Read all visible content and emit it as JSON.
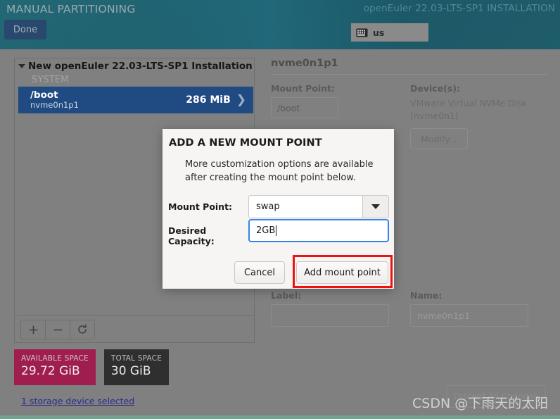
{
  "header": {
    "title": "MANUAL PARTITIONING",
    "product": "openEuler 22.03-LTS-SP1 INSTALLATION",
    "done_label": "Done",
    "keyboard_layout": "us",
    "keyboard_icon": "keyboard-icon",
    "colors": {
      "background_teal": "#1d5c6c",
      "done_button": "#28486e"
    }
  },
  "left_panel": {
    "group": {
      "title": "New openEuler 22.03-LTS-SP1 Installation",
      "expander_icon": "triangle-down-icon",
      "section_label": "SYSTEM",
      "partitions": [
        {
          "mount": "/boot",
          "device": "nvme0n1p1",
          "size": "286 MiB",
          "chevron_icon": "chevron-right-icon",
          "selected": true
        }
      ]
    },
    "toolbar": {
      "add_label": "+",
      "add_icon": "plus-icon",
      "remove_label": "−",
      "remove_icon": "minus-icon",
      "refresh_label": "⟳",
      "refresh_icon": "refresh-icon"
    },
    "space": {
      "available_label": "AVAILABLE SPACE",
      "available_value": "29.72 GiB",
      "available_color": "#9f1e4f",
      "total_label": "TOTAL SPACE",
      "total_value": "30 GiB",
      "total_color": "#2f2f2f"
    },
    "storage_link": "1 storage device selected"
  },
  "right_panel": {
    "title": "nvme0n1p1",
    "mount_point_label": "Mount Point:",
    "mount_point_value": "/boot",
    "devices_label": "Device(s):",
    "devices_value": "VMware Virtual NVMe Disk (nvme0n1)",
    "modify_label": "Modify...",
    "label_label": "Label:",
    "label_value": "",
    "name_label": "Name:",
    "name_value": "nvme0n1p1"
  },
  "footer": {
    "discard_label": "Discard All Changes"
  },
  "dialog": {
    "title": "ADD A NEW MOUNT POINT",
    "description": "More customization options are available after creating the mount point below.",
    "mount_point_label": "Mount Point:",
    "mount_point_value": "swap",
    "mount_point_dropdown_icon": "chevron-down-icon",
    "capacity_label": "Desired Capacity:",
    "capacity_value": "2GB",
    "cancel_label": "Cancel",
    "add_label": "Add mount point",
    "highlight_color": "#ee1111",
    "focus_color": "#3584e4"
  },
  "watermark": {
    "text": "CSDN @下雨天的太阳"
  }
}
